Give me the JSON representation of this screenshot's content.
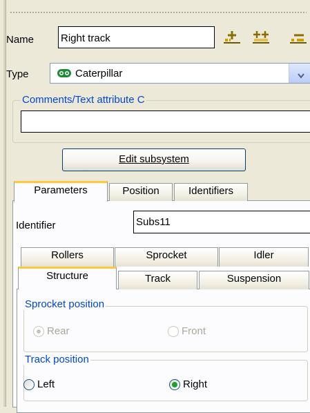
{
  "name_label": "Name",
  "name_value": "Right track",
  "type_label": "Type",
  "type_value": "Caterpillar",
  "comments_title": "Comments/Text attribute C",
  "comments_value": "",
  "edit_subsystem_label": "Edit subsystem",
  "outer_tabs": [
    "Parameters",
    "Position",
    "Identifiers"
  ],
  "identifier_label": "Identifier",
  "identifier_value": "Subs11",
  "inner_tabs_row1": [
    "Rollers",
    "Sprocket",
    "Idler"
  ],
  "inner_tabs_row2": [
    "Structure",
    "Track",
    "Suspension"
  ],
  "sprocket_position": {
    "title": "Sprocket position",
    "options": [
      "Rear",
      "Front"
    ],
    "selected": "Rear",
    "enabled": false
  },
  "track_position": {
    "title": "Track position",
    "options": [
      "Left",
      "Right"
    ],
    "selected": "Right",
    "enabled": true
  },
  "colors": {
    "group_title": "#0046d5",
    "active_tab_highlight": "#ffc83c",
    "radio_selected": "#1aa32a"
  }
}
